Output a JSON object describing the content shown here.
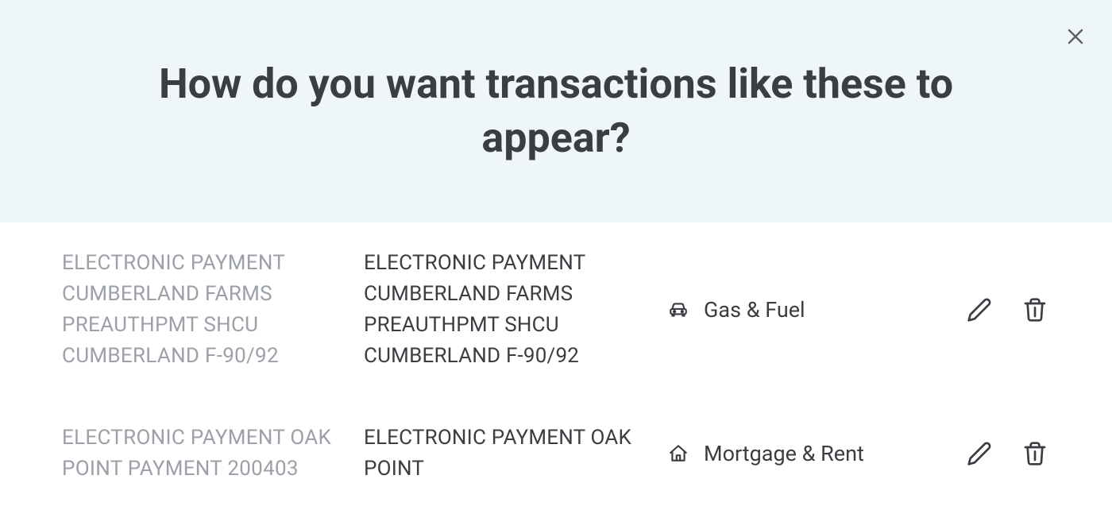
{
  "header": {
    "title": "How do you want transactions like these to appear?"
  },
  "rows": [
    {
      "original": "ELECTRONIC PAYMENT CUMBERLAND FARMS PREAUTHPMT SHCU CUMBERLAND F-90/92",
      "display": "ELECTRONIC PAYMENT CUMBERLAND FARMS PREAUTHPMT SHCU CUMBERLAND F-90/92",
      "category": "Gas & Fuel",
      "category_icon": "car"
    },
    {
      "original": "ELECTRONIC PAYMENT OAK POINT PAYMENT 200403",
      "display": "ELECTRONIC PAYMENT OAK POINT",
      "category": "Mortgage & Rent",
      "category_icon": "home"
    }
  ]
}
